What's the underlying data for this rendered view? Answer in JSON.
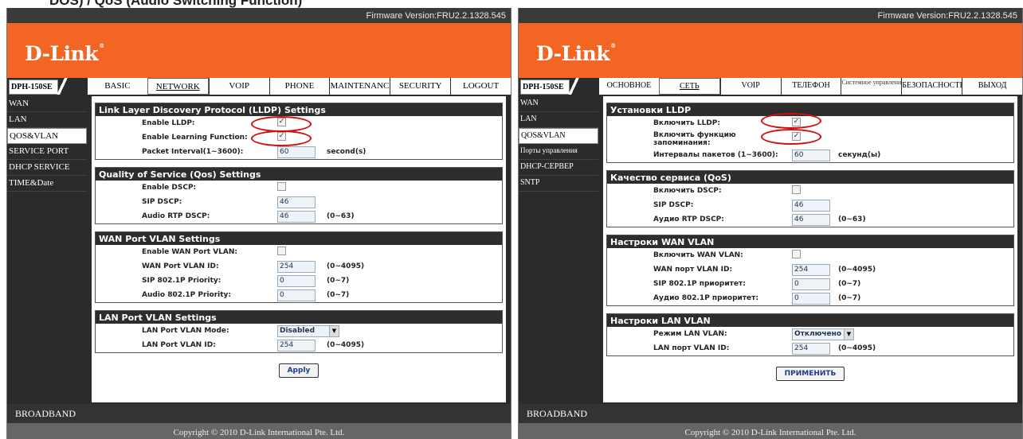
{
  "caption_fragment": "DOS) / QoS (Audio Switching Function)",
  "left": {
    "firmware": "Firmware Version:FRU2.2.1328.545",
    "logo": "D-Link",
    "model": "DPH-150SE",
    "tabs": [
      "BASIC",
      "NETWORK",
      "VOIP",
      "PHONE",
      "MAINTENANCE",
      "SECURITY",
      "LOGOUT"
    ],
    "active_tab": "NETWORK",
    "sidebar": [
      "WAN",
      "LAN",
      "QOS&VLAN",
      "SERVICE PORT",
      "DHCP SERVICE",
      "TIME&Date"
    ],
    "active_side": "QOS&VLAN",
    "lldp": {
      "title": "Link Layer Discovery Protocol (LLDP) Settings",
      "enable_label": "Enable LLDP:",
      "learn_label": "Enable Learning Function:",
      "interval_label": "Packet Interval(1~3600):",
      "interval_value": "60",
      "interval_unit": "second(s)"
    },
    "qos": {
      "title": "Quality of Service (Qos) Settings",
      "dscp_label": "Enable DSCP:",
      "sip_label": "SIP DSCP:",
      "sip_value": "46",
      "rtp_label": "Audio RTP DSCP:",
      "rtp_value": "46",
      "rtp_range": "(0~63)"
    },
    "wan": {
      "title": "WAN Port VLAN Settings",
      "enable_label": "Enable WAN Port VLAN:",
      "id_label": "WAN Port VLAN ID:",
      "id_value": "254",
      "id_range": "(0~4095)",
      "sip_label": "SIP 802.1P Priority:",
      "sip_value": "0",
      "sip_range": "(0~7)",
      "audio_label": "Audio 802.1P Priority:",
      "audio_value": "0",
      "audio_range": "(0~7)"
    },
    "lan": {
      "title": "LAN Port VLAN Settings",
      "mode_label": "LAN Port VLAN Mode:",
      "mode_value": "Disabled",
      "id_label": "LAN Port VLAN ID:",
      "id_value": "254",
      "id_range": "(0~4095)"
    },
    "apply": "Apply",
    "broadband": "BROADBAND",
    "copyright": "Copyright © 2010 D-Link International Pte. Ltd."
  },
  "right": {
    "firmware": "Firmware Version:FRU2.2.1328.545",
    "logo": "D-Link",
    "model": "DPH-150SE",
    "tabs": [
      "ОСНОВНОЕ",
      "СЕТЬ",
      "VOIP",
      "ТЕЛЕФОН",
      "Системное управление",
      "БЕЗОПАСНОСТЬ",
      "ВЫХОД"
    ],
    "active_tab": "СЕТЬ",
    "sidebar": [
      "WAN",
      "LAN",
      "QOS&VLAN",
      "Порты управления",
      "DHCP-СЕРВЕР",
      "SNTP"
    ],
    "active_side": "QOS&VLAN",
    "lldp": {
      "title": "Установки LLDP",
      "enable_label": "Включить LLDP:",
      "learn_label": "Включить функцию запоминания:",
      "interval_label": "Интервалы пакетов (1~3600):",
      "interval_value": "60",
      "interval_unit": "секунд(ы)"
    },
    "qos": {
      "title": "Качество сервиса (QoS)",
      "dscp_label": "Включить DSCP:",
      "sip_label": "SIP DSCP:",
      "sip_value": "46",
      "rtp_label": "Аудио RTP DSCP:",
      "rtp_value": "46",
      "rtp_range": "(0~63)"
    },
    "wan": {
      "title": "Настроки WAN VLAN",
      "enable_label": "Включить WAN VLAN:",
      "id_label": "WAN порт VLAN ID:",
      "id_value": "254",
      "id_range": "(0~4095)",
      "sip_label": "SIP 802.1P приоритет:",
      "sip_value": "0",
      "sip_range": "(0~7)",
      "audio_label": "Аудио 802.1P приоритет:",
      "audio_value": "0",
      "audio_range": "(0~7)"
    },
    "lan": {
      "title": "Настроки LAN VLAN",
      "mode_label": "Режим LAN VLAN:",
      "mode_value": "Отключено",
      "id_label": "LAN порт VLAN ID:",
      "id_value": "254",
      "id_range": "(0~4095)"
    },
    "apply": "ПРИМЕНИТЬ",
    "broadband": "BROADBAND",
    "copyright": "Copyright © 2010 D-Link International Pte. Ltd."
  },
  "checkbox_state": {
    "lldp_enable": true,
    "learning": true,
    "dscp": false,
    "wan_vlan": false
  },
  "colors": {
    "brand_orange": "#f26522",
    "dark": "#2b2b2b",
    "highlight_red": "#d01010"
  }
}
